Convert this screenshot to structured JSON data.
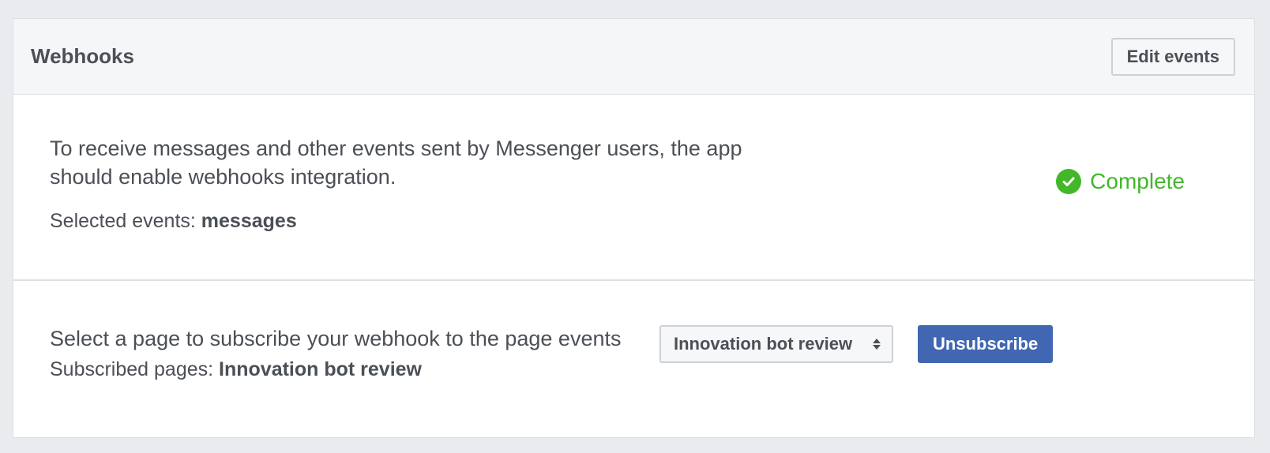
{
  "panel": {
    "title": "Webhooks",
    "edit_button_label": "Edit events"
  },
  "integration": {
    "description": "To receive messages and other events sent by Messenger users, the app should enable webhooks integration.",
    "selected_events_label": "Selected events: ",
    "selected_events_value": "messages",
    "status_icon": "check-circle-icon",
    "status_text": "Complete",
    "status_color": "#42b72a"
  },
  "subscription": {
    "instruction": "Select a page to subscribe your webhook to the page events",
    "subscribed_pages_label": "Subscribed pages: ",
    "subscribed_pages_value": "Innovation bot review",
    "page_select_value": "Innovation bot review",
    "unsubscribe_label": "Unsubscribe",
    "primary_color": "#4267b2"
  }
}
